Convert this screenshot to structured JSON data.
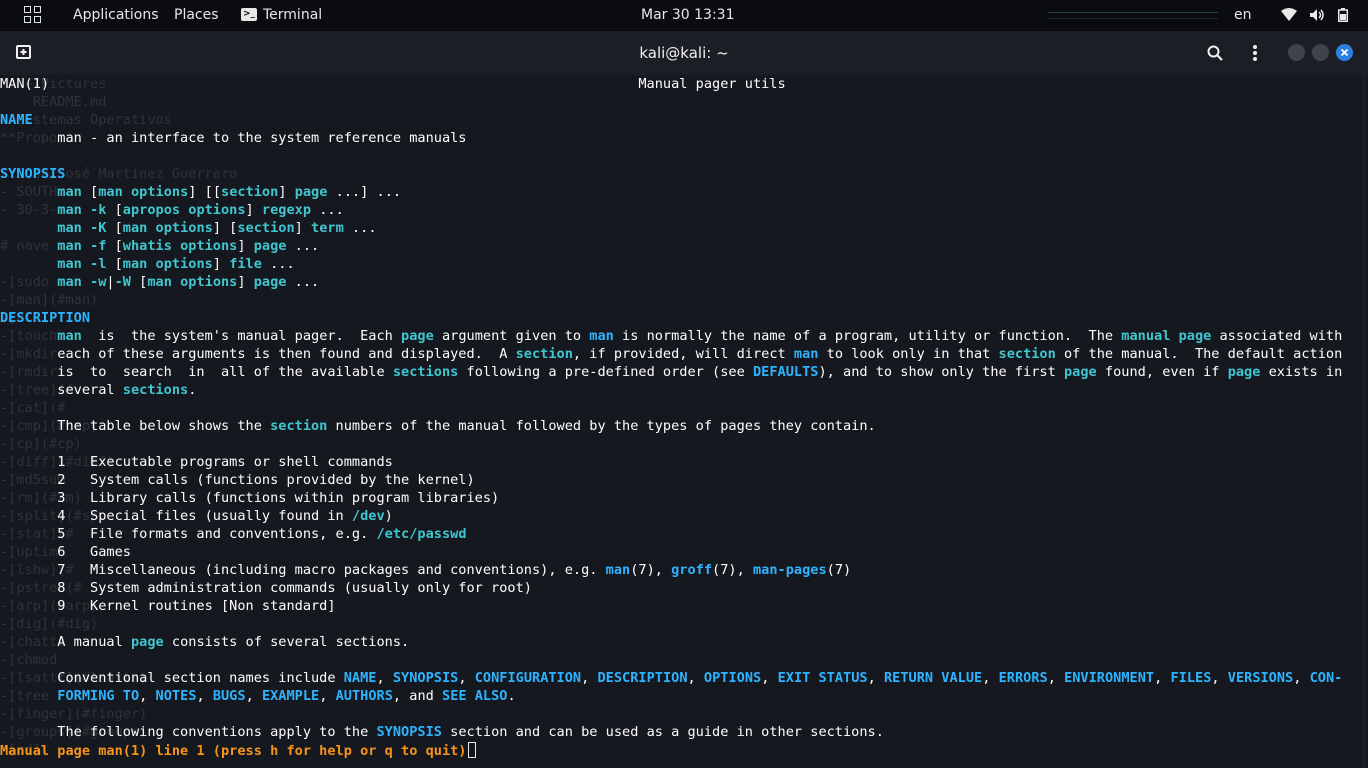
{
  "panel": {
    "applications": "Applications",
    "places": "Places",
    "terminal": "Terminal",
    "clock": "Mar 30  13:31",
    "lang": "en",
    "icons": [
      "apps-grid-icon",
      "terminal-icon",
      "wifi-icon",
      "volume-icon",
      "battery-icon"
    ]
  },
  "header": {
    "title": "kali@kali: ~",
    "icons": [
      "new-tab-icon",
      "search-icon",
      "menu-dots-icon",
      "minimize-icon",
      "maximize-icon",
      "close-icon"
    ],
    "close_color": "#2d7fe2"
  },
  "ghost_text": [
    "   ~/Pictures",
    "    README.md",
    "# Sistemas Operativos",
    "**Propo",
    "",
    "- José José Martínez Guerrero",
    "- SOUTH",
    "- 30-3-",
    "",
    "# nave",
    "",
    "-[sudo",
    "-[man](#man)",
    "-[cl",
    "-[touch",
    "-[mkdir",
    "-[rmdir",
    "-[tree](#",
    "-[cat](#",
    "-[cmp](#cmp)",
    "-[cp](#cp)",
    "-[diff](#diff)",
    "-[md5sum",
    "-[rm](#rm)",
    "-[split](#sp",
    "-[stat](#",
    "-[uptime",
    "-[lshw](#",
    "-[pstree(#",
    "-[arp](#arp)",
    "-[dig](#dig)",
    "-[chattr",
    "-[chmod",
    "-[lsattr](#lsattr)",
    "-[tree",
    "-[finger](#finger)",
    "-[groups](#groups)",
    "-[cd]"
  ],
  "man": {
    "hdr_left": "MAN(1)",
    "hdr_center": "Manual pager utils",
    "hdr_right": "MAN(1)",
    "name_heading": "NAME",
    "name_line": "man - an interface to the system reference manuals",
    "synopsis_heading": "SYNOPSIS",
    "description_heading": "DESCRIPTION",
    "status": "Manual page man(1) line 1 (press h for help or q to quit)"
  },
  "lines": [
    [
      [
        "p",
        "MAN(1)                                                                        Manual pager utils                                                                        MAN(1)"
      ]
    ],
    [],
    [
      [
        "h",
        "NAME"
      ]
    ],
    [
      [
        "p",
        "       man - an interface to the system reference manuals"
      ]
    ],
    [],
    [
      [
        "h",
        "SYNOPSIS"
      ]
    ],
    [
      [
        "p",
        "       "
      ],
      [
        "c",
        "man"
      ],
      [
        "p",
        " ["
      ],
      [
        "c",
        "man options"
      ],
      [
        "p",
        "] [["
      ],
      [
        "c",
        "section"
      ],
      [
        "p",
        "] "
      ],
      [
        "c",
        "page"
      ],
      [
        "p",
        " ...] ..."
      ]
    ],
    [
      [
        "p",
        "       "
      ],
      [
        "c",
        "man -k"
      ],
      [
        "p",
        " ["
      ],
      [
        "c",
        "apropos options"
      ],
      [
        "p",
        "] "
      ],
      [
        "c",
        "regexp"
      ],
      [
        "p",
        " ..."
      ]
    ],
    [
      [
        "p",
        "       "
      ],
      [
        "c",
        "man -K"
      ],
      [
        "p",
        " ["
      ],
      [
        "c",
        "man options"
      ],
      [
        "p",
        "] ["
      ],
      [
        "c",
        "section"
      ],
      [
        "p",
        "] "
      ],
      [
        "c",
        "term"
      ],
      [
        "p",
        " ..."
      ]
    ],
    [
      [
        "p",
        "       "
      ],
      [
        "c",
        "man -f"
      ],
      [
        "p",
        " ["
      ],
      [
        "c",
        "whatis options"
      ],
      [
        "p",
        "] "
      ],
      [
        "c",
        "page"
      ],
      [
        "p",
        " ..."
      ]
    ],
    [
      [
        "p",
        "       "
      ],
      [
        "c",
        "man -l"
      ],
      [
        "p",
        " ["
      ],
      [
        "c",
        "man options"
      ],
      [
        "p",
        "] "
      ],
      [
        "c",
        "file"
      ],
      [
        "p",
        " ..."
      ]
    ],
    [
      [
        "p",
        "       "
      ],
      [
        "c",
        "man -w"
      ],
      [
        "p",
        "|"
      ],
      [
        "c",
        "-W"
      ],
      [
        "p",
        " ["
      ],
      [
        "c",
        "man options"
      ],
      [
        "p",
        "] "
      ],
      [
        "c",
        "page"
      ],
      [
        "p",
        " ..."
      ]
    ],
    [],
    [
      [
        "h",
        "DESCRIPTION"
      ]
    ],
    [
      [
        "p",
        "       "
      ],
      [
        "c",
        "man"
      ],
      [
        "p",
        "  is  the system's manual pager.  Each "
      ],
      [
        "c",
        "page"
      ],
      [
        "p",
        " argument given to "
      ],
      [
        "h",
        "man"
      ],
      [
        "p",
        " is normally the name of a program, utility or function.  The "
      ],
      [
        "c",
        "manual page"
      ],
      [
        "p",
        " associated with"
      ]
    ],
    [
      [
        "p",
        "       each of these arguments is then found and displayed.  A "
      ],
      [
        "c",
        "section"
      ],
      [
        "p",
        ", if provided, will direct "
      ],
      [
        "h",
        "man"
      ],
      [
        "p",
        " to look only in that "
      ],
      [
        "c",
        "section"
      ],
      [
        "p",
        " of the manual.  The default action"
      ]
    ],
    [
      [
        "p",
        "       is  to  search  in  all of the available "
      ],
      [
        "c",
        "sections"
      ],
      [
        "p",
        " following a pre-defined order (see "
      ],
      [
        "h",
        "DEFAULTS"
      ],
      [
        "p",
        "), and to show only the first "
      ],
      [
        "c",
        "page"
      ],
      [
        "p",
        " found, even if "
      ],
      [
        "c",
        "page"
      ],
      [
        "p",
        " exists in"
      ]
    ],
    [
      [
        "p",
        "       several "
      ],
      [
        "c",
        "sections"
      ],
      [
        "p",
        "."
      ]
    ],
    [],
    [
      [
        "p",
        "       The table below shows the "
      ],
      [
        "c",
        "section"
      ],
      [
        "p",
        " numbers of the manual followed by the types of pages they contain."
      ]
    ],
    [],
    [
      [
        "p",
        "       1   Executable programs or shell commands"
      ]
    ],
    [
      [
        "p",
        "       2   System calls (functions provided by the kernel)"
      ]
    ],
    [
      [
        "p",
        "       3   Library calls (functions within program libraries)"
      ]
    ],
    [
      [
        "p",
        "       4   Special files (usually found in "
      ],
      [
        "c",
        "/dev"
      ],
      [
        "p",
        ")"
      ]
    ],
    [
      [
        "p",
        "       5   File formats and conventions, e.g. "
      ],
      [
        "c",
        "/etc/passwd"
      ]
    ],
    [
      [
        "p",
        "       6   Games"
      ]
    ],
    [
      [
        "p",
        "       7   Miscellaneous (including macro packages and conventions), e.g. "
      ],
      [
        "h",
        "man"
      ],
      [
        "p",
        "(7), "
      ],
      [
        "h",
        "groff"
      ],
      [
        "p",
        "(7), "
      ],
      [
        "h",
        "man-pages"
      ],
      [
        "p",
        "(7)"
      ]
    ],
    [
      [
        "p",
        "       8   System administration commands (usually only for root)"
      ]
    ],
    [
      [
        "p",
        "       9   Kernel routines [Non standard]"
      ]
    ],
    [],
    [
      [
        "p",
        "       A manual "
      ],
      [
        "c",
        "page"
      ],
      [
        "p",
        " consists of several sections."
      ]
    ],
    [],
    [
      [
        "p",
        "       Conventional section names include "
      ],
      [
        "h",
        "NAME"
      ],
      [
        "p",
        ", "
      ],
      [
        "h",
        "SYNOPSIS"
      ],
      [
        "p",
        ", "
      ],
      [
        "h",
        "CONFIGURATION"
      ],
      [
        "p",
        ", "
      ],
      [
        "h",
        "DESCRIPTION"
      ],
      [
        "p",
        ", "
      ],
      [
        "h",
        "OPTIONS"
      ],
      [
        "p",
        ", "
      ],
      [
        "h",
        "EXIT STATUS"
      ],
      [
        "p",
        ", "
      ],
      [
        "h",
        "RETURN VALUE"
      ],
      [
        "p",
        ", "
      ],
      [
        "h",
        "ERRORS"
      ],
      [
        "p",
        ", "
      ],
      [
        "h",
        "ENVIRONMENT"
      ],
      [
        "p",
        ", "
      ],
      [
        "h",
        "FILES"
      ],
      [
        "p",
        ", "
      ],
      [
        "h",
        "VERSIONS"
      ],
      [
        "p",
        ", "
      ],
      [
        "h",
        "CON-"
      ]
    ],
    [
      [
        "p",
        "       "
      ],
      [
        "h",
        "FORMING TO"
      ],
      [
        "p",
        ", "
      ],
      [
        "h",
        "NOTES"
      ],
      [
        "p",
        ", "
      ],
      [
        "h",
        "BUGS"
      ],
      [
        "p",
        ", "
      ],
      [
        "h",
        "EXAMPLE"
      ],
      [
        "p",
        ", "
      ],
      [
        "h",
        "AUTHORS"
      ],
      [
        "p",
        ", and "
      ],
      [
        "h",
        "SEE ALSO"
      ],
      [
        "p",
        "."
      ]
    ],
    [],
    [
      [
        "p",
        "       The following conventions apply to the "
      ],
      [
        "h",
        "SYNOPSIS"
      ],
      [
        "p",
        " section and can be used as a guide in other sections."
      ]
    ]
  ]
}
